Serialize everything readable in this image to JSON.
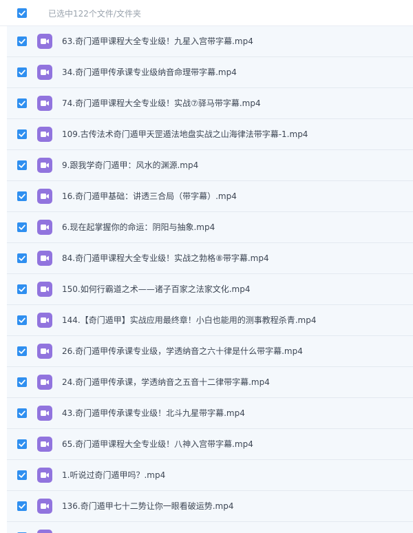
{
  "header": {
    "selection_label": "已选中122个文件/文件夹"
  },
  "files": [
    {
      "name": "63.奇门遁甲课程大全专业级！九星入宫带字幕.mp4"
    },
    {
      "name": "34.奇门遁甲传承课专业级纳音命理带字幕.mp4"
    },
    {
      "name": "74.奇门遁甲课程大全专业级！实战⑦驿马带字幕.mp4"
    },
    {
      "name": "109.古传法术奇门遁甲天罡遁法地盘实战之山海律法带字幕-1.mp4"
    },
    {
      "name": "9.跟我学奇门遁甲：风水的渊源.mp4"
    },
    {
      "name": "16.奇门遁甲基础：讲透三合局（带字幕）.mp4"
    },
    {
      "name": "6.现在起掌握你的命运：阴阳与抽象.mp4"
    },
    {
      "name": "84.奇门遁甲课程大全专业级！实战之勃格⑧带字幕.mp4"
    },
    {
      "name": "150.如何行霸道之术——诸子百家之法家文化.mp4"
    },
    {
      "name": "144.【奇门遁甲】实战应用最终章！小白也能用的测事教程杀青.mp4"
    },
    {
      "name": "26.奇门遁甲传承课专业级，学透纳音之六十律是什么带字幕.mp4"
    },
    {
      "name": "24.奇门遁甲传承课，学透纳音之五音十二律带字幕.mp4"
    },
    {
      "name": "43.奇门遁甲传承课专业级！北斗九星带字幕.mp4"
    },
    {
      "name": "65.奇门遁甲课程大全专业级！八神入宫带字幕.mp4"
    },
    {
      "name": "1.听说过奇门遁甲吗？.mp4"
    },
    {
      "name": "136.奇门遁甲七十二势让你一眼看破运势.mp4"
    },
    {
      "name": ""
    }
  ]
}
